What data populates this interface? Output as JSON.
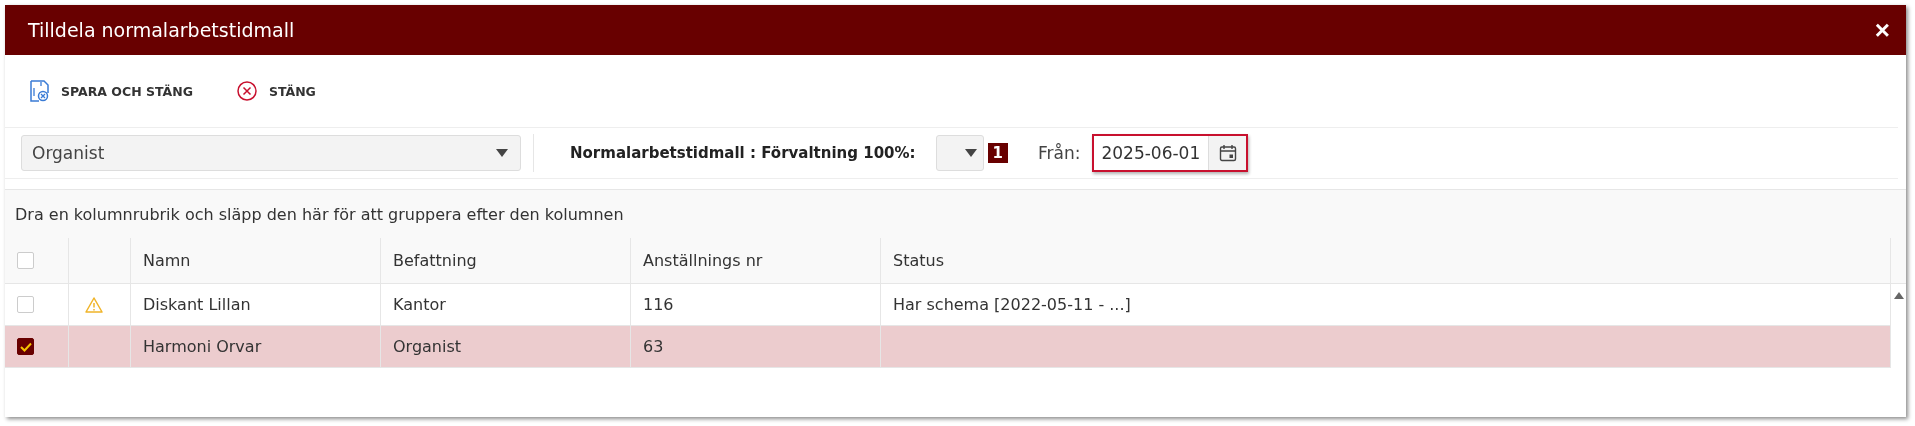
{
  "window": {
    "title": "Tilldela normalarbetstidmall",
    "close": "×"
  },
  "toolbar": [
    {
      "kind": "save",
      "label": "SPARA OCH STÄNG"
    },
    {
      "kind": "close",
      "label": "STÄNG"
    }
  ],
  "filter": {
    "role": "Organist",
    "template_label": "Normalarbetstidmall : Förvaltning 100%:",
    "badge": "1",
    "from_label": "Från:",
    "from_value": "2025-06-01"
  },
  "group_panel": "Dra en kolumnrubrik och släpp den här för att gruppera efter den kolumnen",
  "table": {
    "columns": [
      "Namn",
      "Befattning",
      "Anställnings nr",
      "Status"
    ],
    "all_checked": false,
    "rows": [
      {
        "checked": false,
        "warning": true,
        "cells": [
          "Diskant Lillan",
          "Kantor",
          "116",
          "Har schema [2022-05-11 - ...]"
        ]
      },
      {
        "checked": true,
        "warning": false,
        "cells": [
          "Harmoni Orvar",
          "Organist",
          "63",
          ""
        ]
      }
    ]
  }
}
